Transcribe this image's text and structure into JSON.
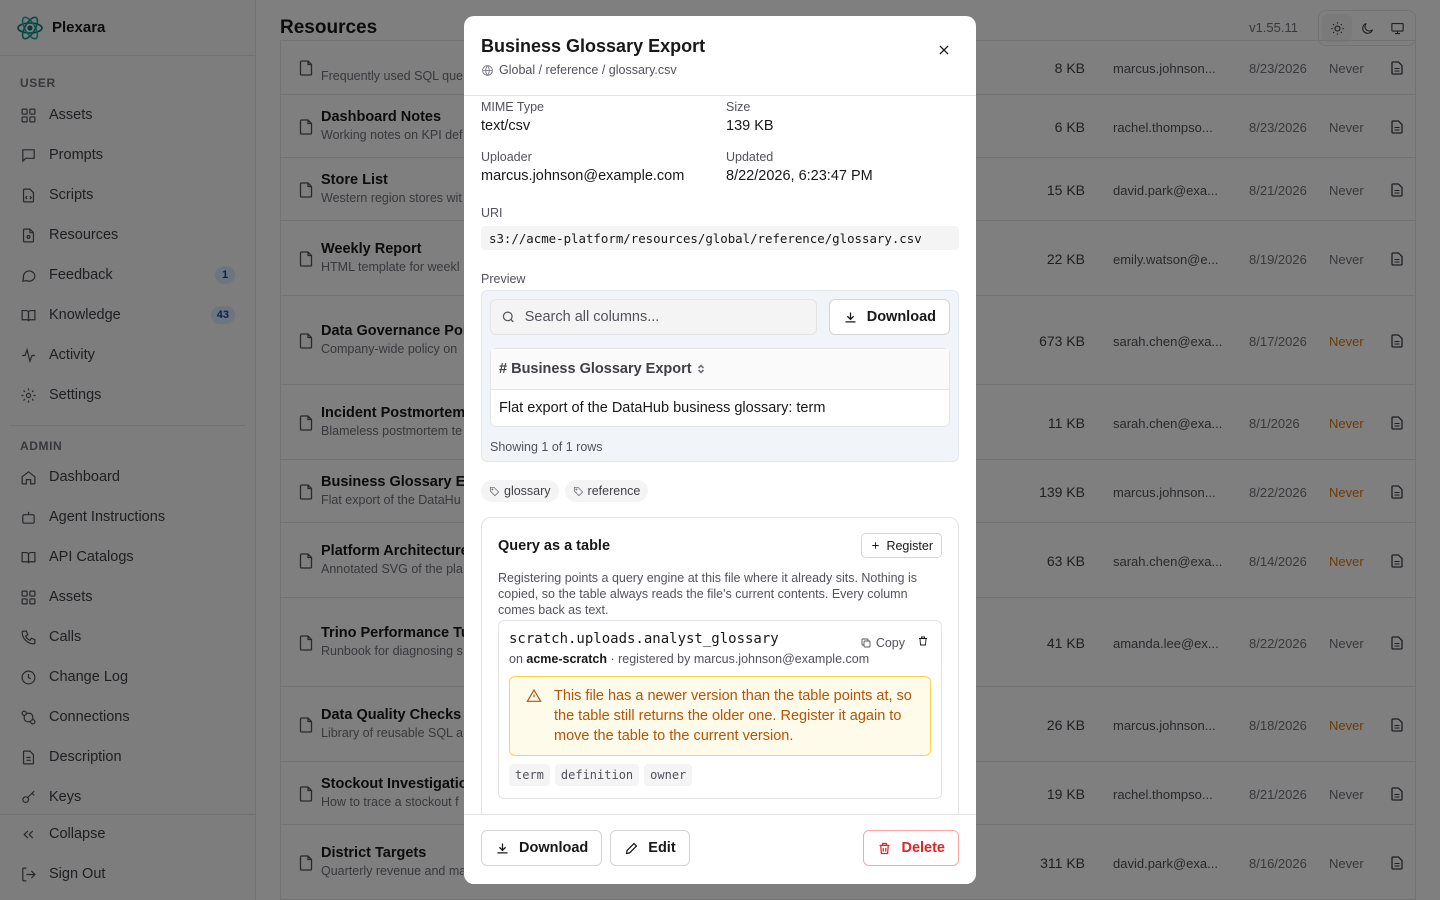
{
  "app": {
    "name": "Plexara",
    "version": "v1.55.11"
  },
  "sidebar": {
    "user_label": "USER",
    "user_items": [
      {
        "label": "Assets",
        "icon": "grid-icon"
      },
      {
        "label": "Prompts",
        "icon": "message-icon"
      },
      {
        "label": "Scripts",
        "icon": "code-icon"
      },
      {
        "label": "Resources",
        "icon": "file-icon"
      },
      {
        "label": "Feedback",
        "icon": "chat-icon",
        "badge": "1"
      },
      {
        "label": "Knowledge",
        "icon": "book-icon",
        "badge": "43"
      },
      {
        "label": "Activity",
        "icon": "activity-icon"
      },
      {
        "label": "Settings",
        "icon": "gear-icon"
      }
    ],
    "admin_label": "ADMIN",
    "admin_items": [
      {
        "label": "Dashboard",
        "icon": "home-icon"
      },
      {
        "label": "Agent Instructions",
        "icon": "bot-icon"
      },
      {
        "label": "API Catalogs",
        "icon": "book-icon"
      },
      {
        "label": "Assets",
        "icon": "grid-icon"
      },
      {
        "label": "Calls",
        "icon": "phone-icon"
      },
      {
        "label": "Change Log",
        "icon": "clock-icon"
      },
      {
        "label": "Connections",
        "icon": "connection-icon"
      },
      {
        "label": "Description",
        "icon": "document-icon"
      },
      {
        "label": "Keys",
        "icon": "key-icon"
      }
    ],
    "collapse_label": "Collapse",
    "signout_label": "Sign Out"
  },
  "header": {
    "title": "Resources"
  },
  "table": {
    "rows": [
      {
        "name": "",
        "desc": "Frequently used SQL que",
        "size": "8 KB",
        "owner": "marcus.johnson...",
        "date": "8/23/2026",
        "expires": "Never",
        "warn": false
      },
      {
        "name": "Dashboard Notes",
        "desc": "Working notes on KPI def",
        "size": "6 KB",
        "owner": "rachel.thompso...",
        "date": "8/23/2026",
        "expires": "Never",
        "warn": false
      },
      {
        "name": "Store List",
        "desc": "Western region stores wit",
        "size": "15 KB",
        "owner": "david.park@exa...",
        "date": "8/21/2026",
        "expires": "Never",
        "warn": false
      },
      {
        "name": "Weekly Report",
        "desc": "HTML template for weekl",
        "size": "22 KB",
        "owner": "emily.watson@e...",
        "date": "8/19/2026",
        "expires": "Never",
        "warn": false
      },
      {
        "name": "Data Governance Poli",
        "desc": "Company-wide policy on",
        "size": "673 KB",
        "owner": "sarah.chen@exa...",
        "date": "8/17/2026",
        "expires": "Never",
        "warn": true
      },
      {
        "name": "Incident Postmortem",
        "desc": "Blameless postmortem te",
        "size": "11 KB",
        "owner": "sarah.chen@exa...",
        "date": "8/1/2026",
        "expires": "Never",
        "warn": true
      },
      {
        "name": "Business Glossary Ex",
        "desc": "Flat export of the DataHu",
        "size": "139 KB",
        "owner": "marcus.johnson...",
        "date": "8/22/2026",
        "expires": "Never",
        "warn": true
      },
      {
        "name": "Platform Architecture",
        "desc": "Annotated SVG of the pla",
        "size": "63 KB",
        "owner": "sarah.chen@exa...",
        "date": "8/14/2026",
        "expires": "Never",
        "warn": true
      },
      {
        "name": "Trino Performance Tu",
        "desc": "Runbook for diagnosing s",
        "size": "41 KB",
        "owner": "amanda.lee@ex...",
        "date": "8/22/2026",
        "expires": "Never",
        "warn": false
      },
      {
        "name": "Data Quality Checks",
        "desc": "Library of reusable SQL a",
        "size": "26 KB",
        "owner": "marcus.johnson...",
        "date": "8/18/2026",
        "expires": "Never",
        "warn": true
      },
      {
        "name": "Stockout Investigation",
        "desc": "How to trace a stockout f",
        "size": "19 KB",
        "owner": "rachel.thompso...",
        "date": "8/21/2026",
        "expires": "Never",
        "warn": false
      },
      {
        "name": "District Targets",
        "desc": "Quarterly revenue and ma",
        "size": "311 KB",
        "owner": "david.park@exa...",
        "date": "8/16/2026",
        "expires": "Never",
        "warn": false
      }
    ]
  },
  "modal": {
    "title": "Business Glossary Export",
    "path": "Global / reference / glossary.csv",
    "mime_label": "MIME Type",
    "mime_value": "text/csv",
    "size_label": "Size",
    "size_value": "139 KB",
    "uploader_label": "Uploader",
    "uploader_value": "marcus.johnson@example.com",
    "updated_label": "Updated",
    "updated_value": "8/22/2026, 6:23:47 PM",
    "uri_label": "URI",
    "uri_value": "s3://acme-platform/resources/global/reference/glossary.csv",
    "preview_label": "Preview",
    "search_placeholder": "Search all columns...",
    "download_label": "Download",
    "preview_header": "# Business Glossary Export",
    "preview_cell": "Flat export of the DataHub business glossary: term",
    "preview_count": "Showing 1 of 1 rows",
    "tags": [
      "glossary",
      "reference"
    ],
    "query": {
      "title": "Query as a table",
      "register_label": "Register",
      "description": "Registering points a query engine at this file where it already sits. Nothing is copied, so the table always reads the file's current contents. Every column comes back as text.",
      "table_name": "scratch.uploads.analyst_glossary",
      "on_label": "on",
      "engine": "acme-scratch",
      "registered_by": "· registered by marcus.johnson@example.com",
      "copy_label": "Copy",
      "warning": "This file has a newer version than the table points at, so the table still returns the older one. Register it again to move the table to the current version.",
      "columns": [
        "term",
        "definition",
        "owner"
      ]
    },
    "footer": {
      "download_label": "Download",
      "edit_label": "Edit",
      "delete_label": "Delete"
    }
  }
}
